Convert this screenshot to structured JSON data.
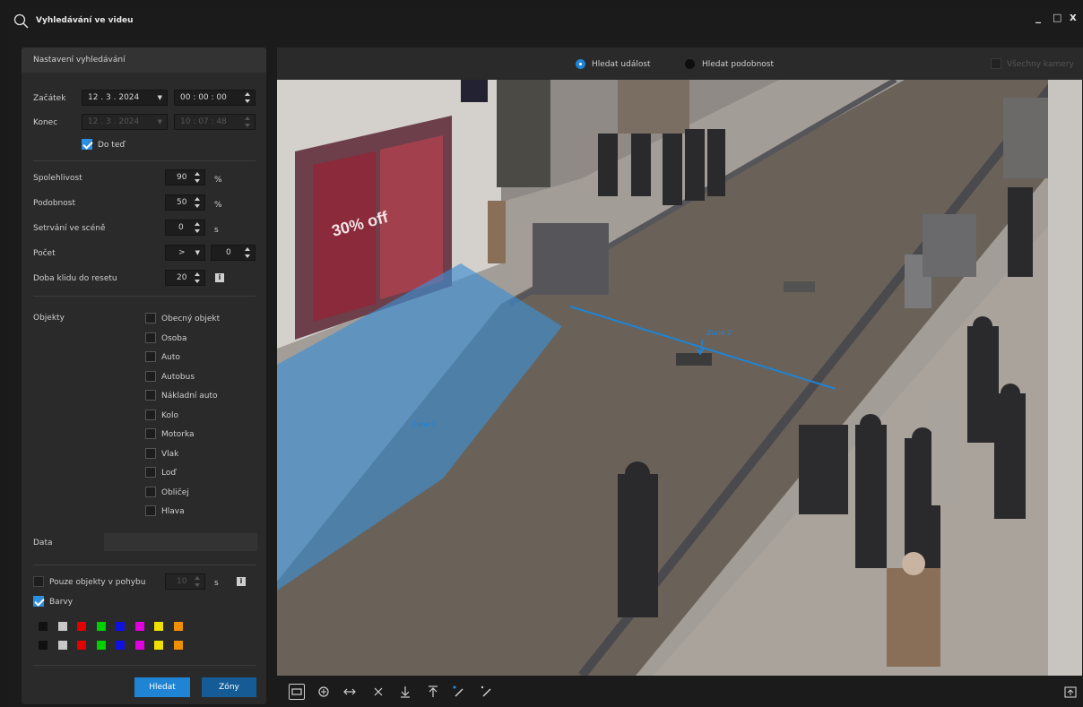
{
  "window": {
    "title": "Vyhledávání ve videu",
    "minimize": "_",
    "maximize": "□",
    "close": "x"
  },
  "settings": {
    "header": "Nastavení vyhledávání",
    "start": {
      "label": "Začátek",
      "date": "12 . 3 . 2024",
      "time": "00 : 00 : 00"
    },
    "end": {
      "label": "Konec",
      "date": "12 . 3 . 2024",
      "time": "10 : 07 : 48"
    },
    "until_now": {
      "label": "Do teď",
      "checked": true
    },
    "confidence": {
      "label": "Spolehlivost",
      "value": "90",
      "unit": "%"
    },
    "similarity": {
      "label": "Podobnost",
      "value": "50",
      "unit": "%"
    },
    "dwell": {
      "label": "Setrvání ve scéně",
      "value": "0",
      "unit": "s"
    },
    "count": {
      "label": "Počet",
      "operator": ">",
      "value": "0"
    },
    "reset": {
      "label": "Doba klidu do resetu",
      "value": "20",
      "info": "i"
    },
    "objects": {
      "label": "Objekty",
      "items": [
        "Obecný objekt",
        "Osoba",
        "Auto",
        "Autobus",
        "Nákladní auto",
        "Kolo",
        "Motorka",
        "Vlak",
        "Loď",
        "Obličej",
        "Hlava"
      ]
    },
    "data_label": "Data",
    "data_value": "",
    "moving_only": {
      "label": "Pouze objekty v pohybu",
      "value": "10",
      "unit": "s",
      "checked": false,
      "info": "i"
    },
    "colors": {
      "label": "Barvy",
      "checked": true,
      "palette": [
        "#111111",
        "#c8c8c8",
        "#e00000",
        "#00d000",
        "#1010e0",
        "#e000e0",
        "#f0e000",
        "#f09000"
      ]
    },
    "search_button": "Hledat",
    "zones_button": "Zóny"
  },
  "topbar": {
    "search_event": "Hledat událost",
    "search_similarity": "Hledat podobnost",
    "all_cameras": "Všechny kamery"
  },
  "video": {
    "zone1": "Zone 1",
    "zone2": "Zone 2",
    "shop_sign": "30% off"
  },
  "colors": {
    "accent": "#1f84d4",
    "zone_fill": "#3d8fd2",
    "panel": "#2a2a2a",
    "background": "#1b1b1b"
  },
  "toolbar": {
    "tools": [
      "rectangle-icon",
      "crosshair-icon",
      "double-arrow-icon",
      "delete-icon",
      "arrow-down-icon",
      "arrow-up-icon",
      "pencil-add-icon",
      "pencil-icon"
    ],
    "export": "export-icon"
  }
}
